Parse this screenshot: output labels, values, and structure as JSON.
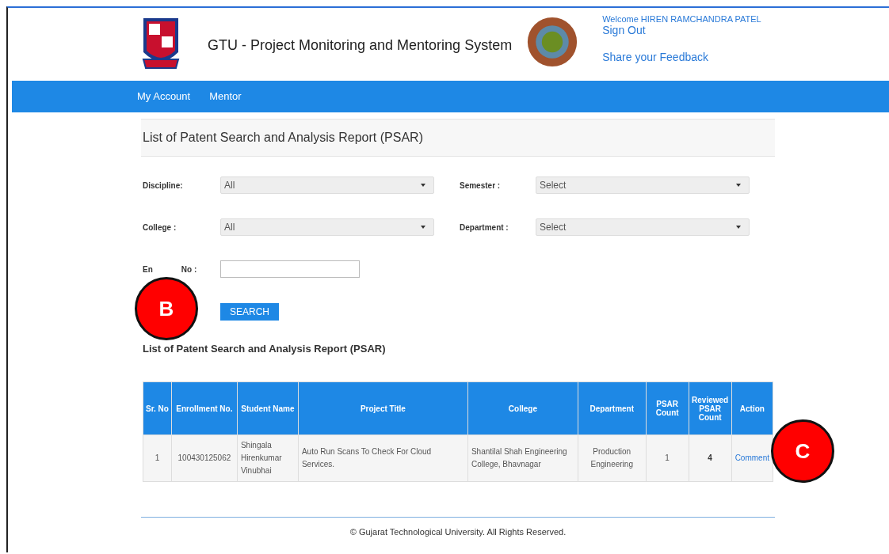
{
  "header": {
    "title": "GTU - Project Monitoring and Mentoring System",
    "welcome": "Welcome HIREN RAMCHANDRA PATEL",
    "sign_out": "Sign Out",
    "feedback": "Share your Feedback"
  },
  "nav": [
    {
      "label": "My Account"
    },
    {
      "label": "Mentor"
    }
  ],
  "page_title": "List of Patent Search and Analysis Report (PSAR)",
  "filters": [
    {
      "label": "Discipline:",
      "kind": "select",
      "value": "All"
    },
    {
      "label": "Semester :",
      "kind": "select",
      "value": "Select"
    },
    {
      "label": "College :",
      "kind": "select",
      "value": "All"
    },
    {
      "label": "Department :",
      "kind": "select",
      "value": "Select"
    },
    {
      "label": "En",
      "label_tail": "No :",
      "kind": "text"
    }
  ],
  "search_button": "SEARCH",
  "table_title": "List of Patent Search and Analysis Report (PSAR)",
  "table": {
    "columns": [
      "Sr. No",
      "Enrollment No.",
      "Student Name",
      "Project Title",
      "College",
      "Department",
      "PSAR Count",
      "Reviewed PSAR Count",
      "Action"
    ],
    "rows": [
      {
        "cells": [
          "1",
          "100430125062",
          "Shingala Hirenkumar Vinubhai",
          "Auto Run Scans To Check For Cloud Services.",
          "Shantilal Shah Engineering College, Bhavnagar",
          "Production Engineering",
          "1",
          "4"
        ],
        "action": "Comment"
      }
    ]
  },
  "footer": "© Gujarat Technological University. All Rights Reserved.",
  "callouts": [
    {
      "label": "B"
    },
    {
      "label": "C"
    }
  ]
}
